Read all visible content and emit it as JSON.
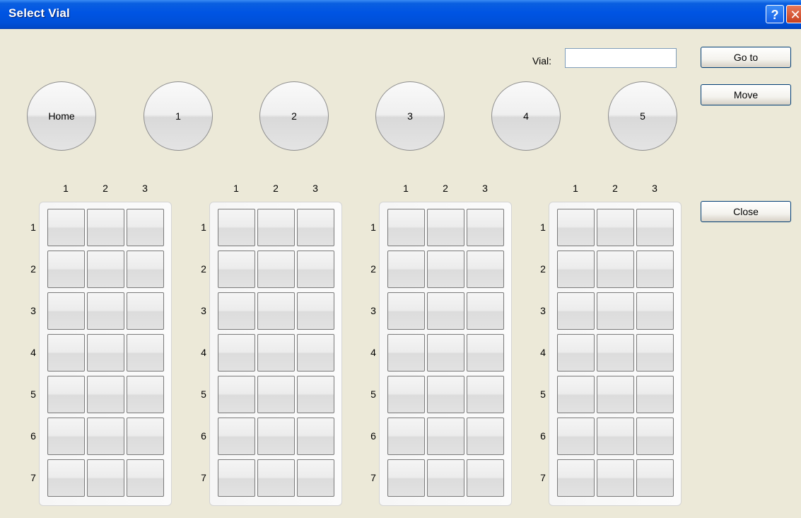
{
  "window": {
    "title": "Select Vial",
    "help_glyph": "?",
    "close_glyph": "✕"
  },
  "vial": {
    "label": "Vial:",
    "value": ""
  },
  "buttons": {
    "goto": "Go to",
    "move": "Move",
    "close": "Close"
  },
  "positions": [
    "Home",
    "1",
    "2",
    "3",
    "4",
    "5"
  ],
  "racks": {
    "count": 4,
    "column_labels": [
      "1",
      "2",
      "3"
    ],
    "row_labels": [
      "1",
      "2",
      "3",
      "4",
      "5",
      "6",
      "7"
    ]
  },
  "colors": {
    "titlebar": "#0054E3",
    "window_bg": "#ECE9D8"
  }
}
